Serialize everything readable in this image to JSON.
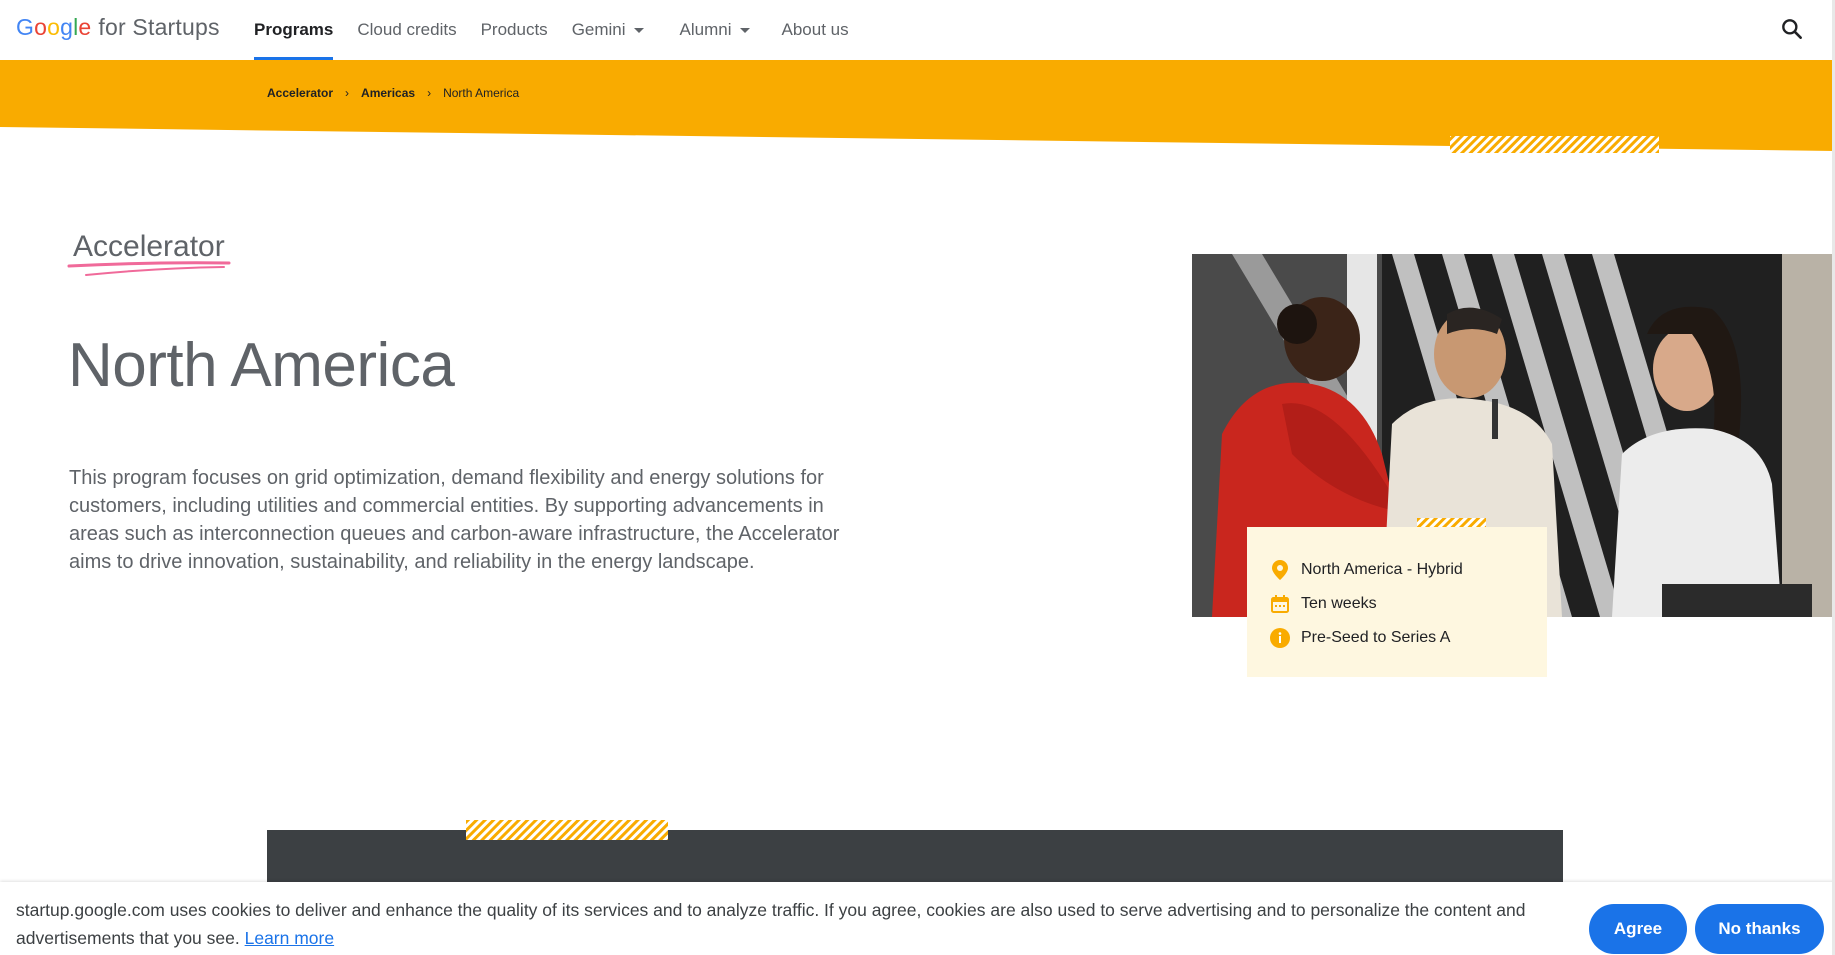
{
  "header": {
    "logo": {
      "google": [
        "G",
        "o",
        "o",
        "g",
        "l",
        "e"
      ],
      "suffix": "for Startups"
    },
    "nav": [
      {
        "label": "Programs",
        "active": true,
        "dropdown": false
      },
      {
        "label": "Cloud credits",
        "active": false,
        "dropdown": false
      },
      {
        "label": "Products",
        "active": false,
        "dropdown": false
      },
      {
        "label": "Gemini",
        "active": false,
        "dropdown": true
      },
      {
        "label": "Alumni",
        "active": false,
        "dropdown": true
      },
      {
        "label": "About us",
        "active": false,
        "dropdown": false
      }
    ],
    "search_icon": "search-icon"
  },
  "breadcrumb": {
    "items": [
      "Accelerator",
      "Americas",
      "North America"
    ],
    "separator": "›"
  },
  "hero": {
    "eyebrow": "Accelerator",
    "title": "North America",
    "description": "This program focuses on grid optimization, demand flexibility and energy solutions for customers, including utilities and commercial entities. By supporting advancements in areas such as interconnection queues and carbon-aware infrastructure, the Accelerator aims to drive innovation, sustainability, and reliability in the energy landscape."
  },
  "info_card": {
    "location": "North America - Hybrid",
    "duration": "Ten weeks",
    "stage": "Pre-Seed to Series A"
  },
  "cookie": {
    "text": "startup.google.com uses cookies to deliver and enhance the quality of its services and to analyze traffic. If you agree, cookies are also used to serve advertising and to personalize the content and advertisements that you see.",
    "learn_more": "Learn more",
    "agree": "Agree",
    "no_thanks": "No thanks"
  },
  "colors": {
    "brand_yellow": "#F9AB00",
    "accent_blue": "#1a73e8",
    "card_bg": "#fef7e0",
    "dark_section": "#3c4043",
    "underline_pink": "#f06a9a"
  }
}
